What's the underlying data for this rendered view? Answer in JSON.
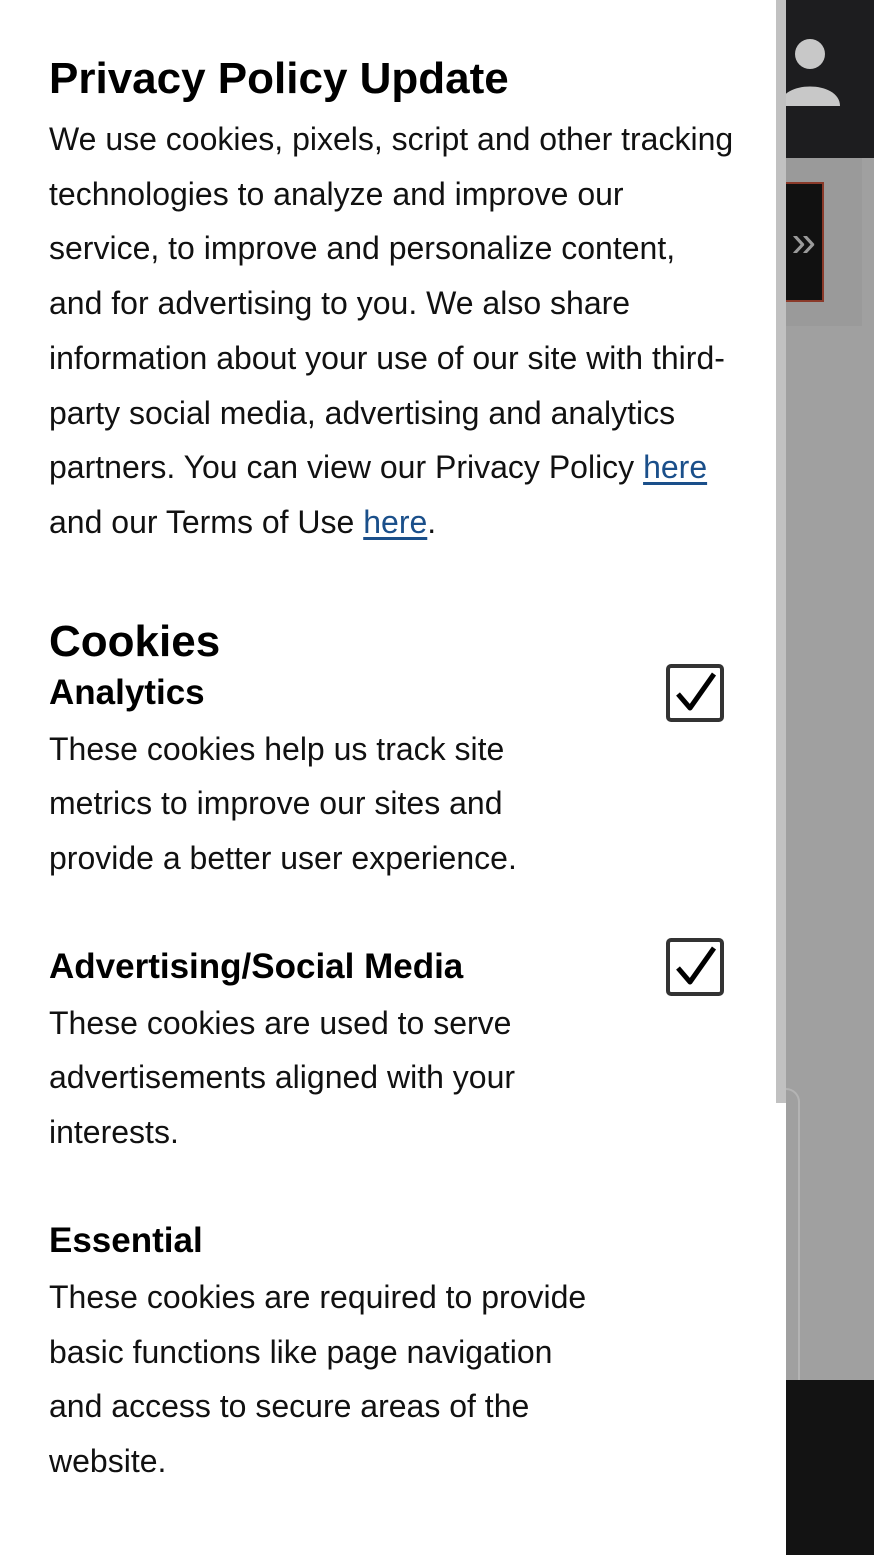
{
  "consent": {
    "title": "Privacy Policy Update",
    "intro_text": "We use cookies, pixels, script and other tracking technologies to analyze and improve our service, to improve and personalize content, and for advertising to you. We also share information about your use of our site with third-party social media, advertising and analytics partners. You can view our Privacy Policy ",
    "privacy_link": "here",
    "intro_middle": " and our Terms of Use ",
    "terms_link": "here",
    "intro_end": ".",
    "cookies_heading": "Cookies",
    "categories": [
      {
        "name": "Analytics",
        "description": "These cookies help us track site metrics to improve our sites and provide a better user experience.",
        "checked": true
      },
      {
        "name": "Advertising/Social Media",
        "description": "These cookies are used to serve advertisements aligned with your interests.",
        "checked": true
      },
      {
        "name": "Essential",
        "description": "These cookies are required to provide basic functions like page navigation and access to secure areas of the website."
      }
    ]
  },
  "background": {
    "next_glyph": "»",
    "icons": [
      "user-icon",
      "chevron-double-right-icon",
      "check-icon"
    ]
  },
  "colors": {
    "link": "#1a4f8a",
    "header_bg": "#1d1d1f",
    "overlay_gray": "#a0a0a0"
  }
}
